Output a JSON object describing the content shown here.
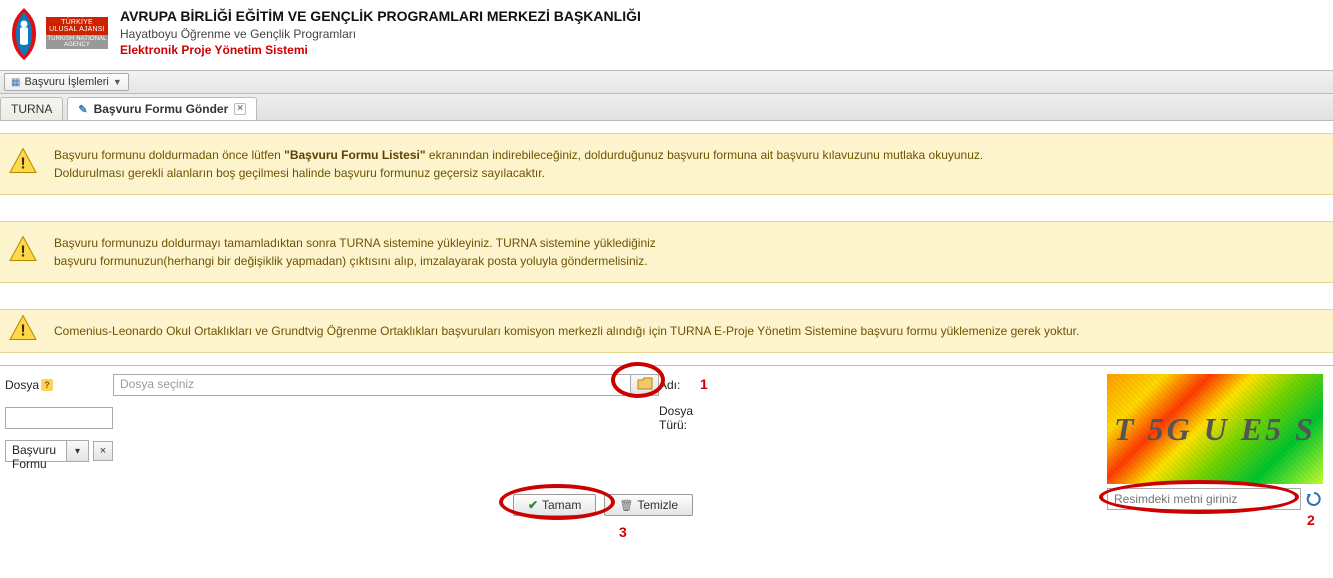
{
  "header": {
    "logo_text_main": "TÜRKİYE ULUSAL AJANSI",
    "logo_text_sub": "TURKISH NATIONAL AGENCY",
    "title_line1": "AVRUPA BİRLİĞİ EĞİTİM VE GENÇLİK PROGRAMLARI MERKEZİ BAŞKANLIĞI",
    "title_line2": "Hayatboyu Öğrenme ve Gençlik Programları",
    "title_line3": "Elektronik Proje Yönetim Sistemi"
  },
  "menubar": {
    "item_basvuru": "Başvuru İşlemleri"
  },
  "tabs": {
    "tab_turna": "TURNA",
    "tab_formgonder": "Başvuru Formu Gönder"
  },
  "warnings": {
    "w1_pre": "Başvuru formunu doldurmadan önce lütfen ",
    "w1_bold": "\"Başvuru Formu Listesi\"",
    "w1_post": " ekranından indirebileceğiniz, doldurduğunuz başvuru formuna ait başvuru kılavuzunu mutlaka okuyunuz.",
    "w1_line2": "Doldurulması gerekli alanların boş geçilmesi halinde başvuru formunuz geçersiz sayılacaktır.",
    "w2_line1": "Başvuru formunuzu doldurmayı tamamladıktan sonra TURNA sistemine yükleyiniz. TURNA sistemine yüklediğiniz",
    "w2_line2": "başvuru formunuzun(herhangi bir değişiklik yapmadan) çıktısını alıp, imzalayarak posta yoluyla göndermelisiniz.",
    "w3": "Comenius-Leonardo Okul Ortaklıkları ve Grundtvig Öğrenme Ortaklıkları başvuruları komisyon merkezli alındığı için TURNA E-Proje Yönetim Sistemine başvuru formu yüklemenize gerek yoktur."
  },
  "form": {
    "label_dosya": "Dosya",
    "label_adi": "Adı:",
    "label_dosyaturu": "Dosya Türü:",
    "file_placeholder": "Dosya seçiniz",
    "adi_value": "",
    "dosyaturu_value": "Başvuru Formu",
    "btn_tamam": "Tamam",
    "btn_temizle": "Temizle"
  },
  "captcha": {
    "image_text": "T 5G U  E5 S",
    "input_placeholder": "Resimdeki metni giriniz"
  },
  "annotations": {
    "n1": "1",
    "n2": "2",
    "n3": "3"
  }
}
